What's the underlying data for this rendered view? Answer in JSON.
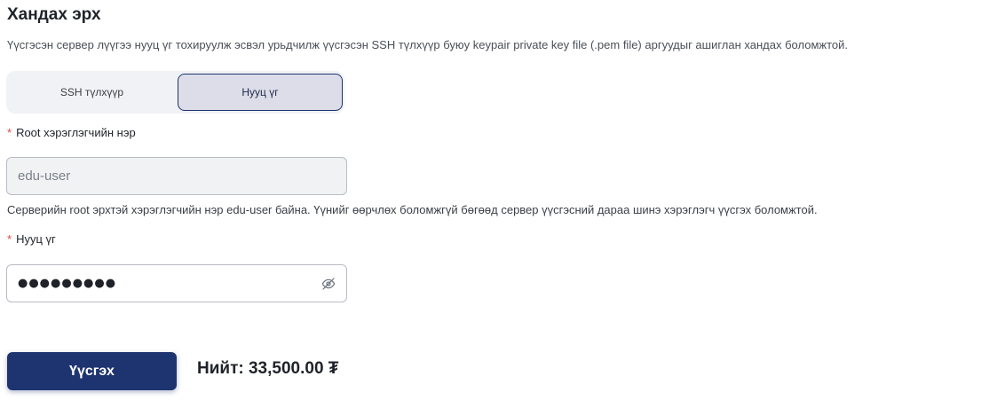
{
  "section": {
    "title": "Хандах эрх",
    "description": "Үүсгэсэн сервер лүүгээ нууц үг тохируулж эсвэл урьдчилж үүсгэсэн SSH түлхүүр буюу keypair private key file (.pem file) аргуудыг ашиглан хандах боломжтой."
  },
  "auth_tabs": {
    "items": [
      {
        "label": "SSH түлхүүр",
        "selected": false
      },
      {
        "label": "Нууц үг",
        "selected": true
      }
    ]
  },
  "root_user": {
    "required_mark": "*",
    "label": "Root хэрэглэгчийн нэр",
    "value": "edu-user",
    "help": "Серверийн root эрхтэй хэрэглэгчийн нэр edu-user байна. Үүнийг өөрчлөх боломжгүй бөгөөд сервер үүсгэсний дараа шинэ хэрэглэгч үүсгэх боломжтой."
  },
  "password": {
    "required_mark": "*",
    "label": "Нууц үг",
    "masked_value": "●●●●●●●●●",
    "toggle_icon": "eye-off-icon"
  },
  "footer": {
    "submit_label": "Үүсгэх",
    "total": "Нийт: 33,500.00 ₮"
  },
  "colors": {
    "primary": "#1e3470",
    "required": "#e54545",
    "tab_selected_bg": "#dcdde8",
    "tab_group_bg": "#f1f2f5"
  }
}
